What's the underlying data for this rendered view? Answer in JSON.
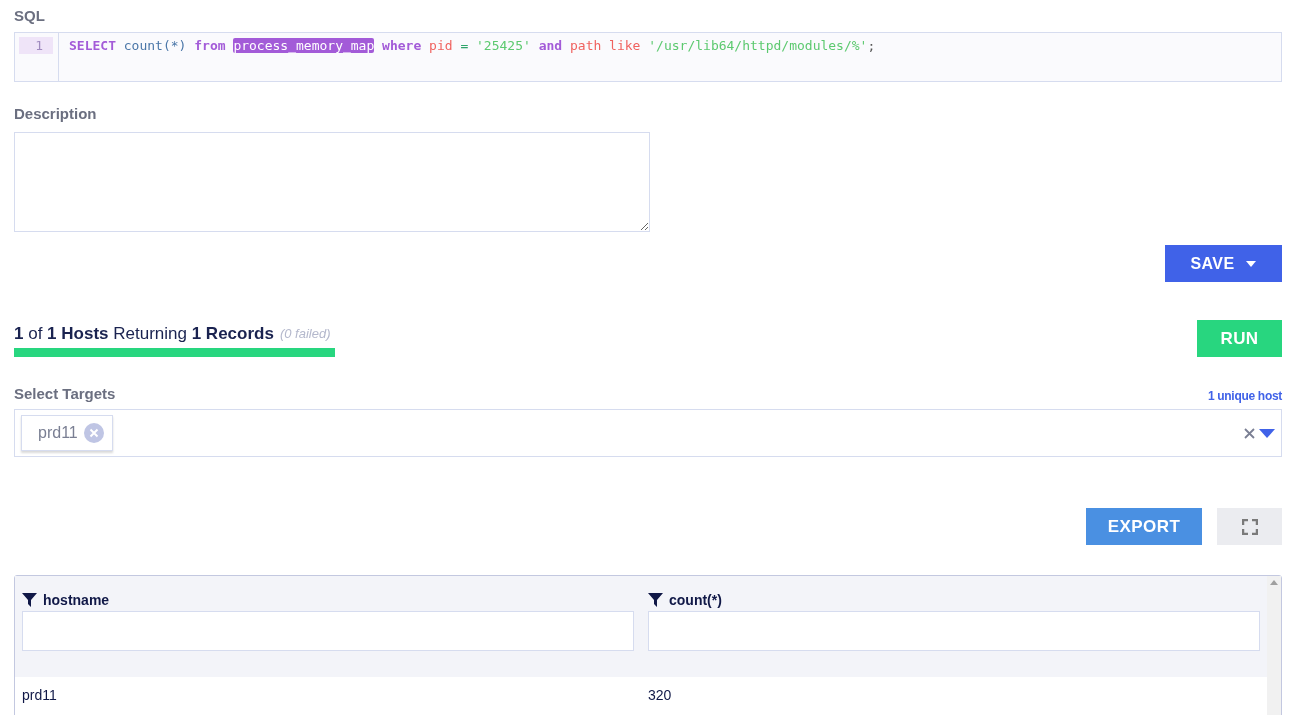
{
  "sql": {
    "label": "SQL",
    "line_number": "1",
    "tokens": [
      {
        "text": "SELECT",
        "kind": "keyword"
      },
      {
        "text": "count(*)",
        "kind": "func"
      },
      {
        "text": "from",
        "kind": "keyword"
      },
      {
        "text": "process_memory_map",
        "kind": "highlight"
      },
      {
        "text": "where",
        "kind": "keyword"
      },
      {
        "text": "pid",
        "kind": "field"
      },
      {
        "text": "=",
        "kind": "operator"
      },
      {
        "text": "'25425'",
        "kind": "string"
      },
      {
        "text": "and",
        "kind": "keyword"
      },
      {
        "text": "path like",
        "kind": "field"
      },
      {
        "text": "'/usr/lib64/httpd/modules/%'",
        "kind": "string"
      },
      {
        "text": ";",
        "kind": "punct"
      }
    ]
  },
  "description": {
    "label": "Description"
  },
  "save_button": {
    "label": "SAVE"
  },
  "results": {
    "summary": "**1** of **1 Hosts** Returning **1 Records**",
    "failed": "(0 failed)",
    "level": 1
  },
  "run_button": {
    "label": "RUN"
  },
  "targets": {
    "label": "Select Targets",
    "unique_hosts": "1 unique host",
    "chips": [
      "prd11"
    ]
  },
  "export_button": {
    "label": "EXPORT"
  },
  "table": {
    "columns": [
      "hostname",
      "count(*)"
    ],
    "rows": [
      [
        "prd11",
        "320"
      ]
    ]
  }
}
